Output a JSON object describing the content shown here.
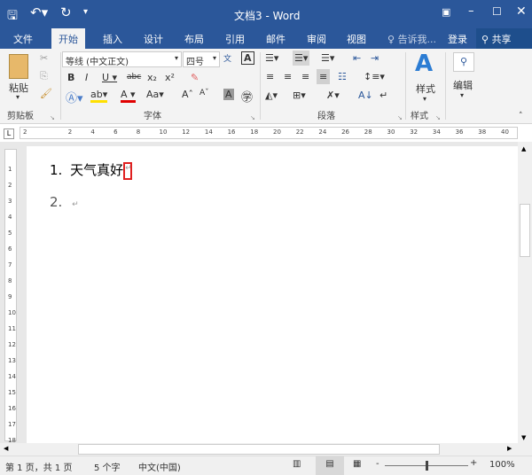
{
  "title": "文档3 - Word",
  "tabs": [
    "文件",
    "开始",
    "插入",
    "设计",
    "布局",
    "引用",
    "邮件",
    "审阅",
    "视图"
  ],
  "tell_me": "告诉我...",
  "login": "登录",
  "share": "共享",
  "font_name": "等线 (中文正文)",
  "font_size": "四号",
  "paste": "粘贴",
  "styles": "样式",
  "editing": "编辑",
  "groups": {
    "clipboard": "剪贴板",
    "font": "字体",
    "paragraph": "段落",
    "styles": "样式"
  },
  "ruler_numbers": [
    "2",
    "2",
    "4",
    "6",
    "8",
    "10",
    "12",
    "14",
    "16",
    "18",
    "20",
    "22",
    "24",
    "26",
    "28",
    "30",
    "32",
    "34",
    "36",
    "38",
    "40"
  ],
  "doc": {
    "items": [
      {
        "num": "1.",
        "text": "天气真好"
      },
      {
        "num": "2.",
        "text": ""
      }
    ]
  },
  "status": {
    "page": "第 1 页，共 1 页",
    "words": "5 个字",
    "lang": "中文(中国)",
    "zoom": "100%"
  }
}
